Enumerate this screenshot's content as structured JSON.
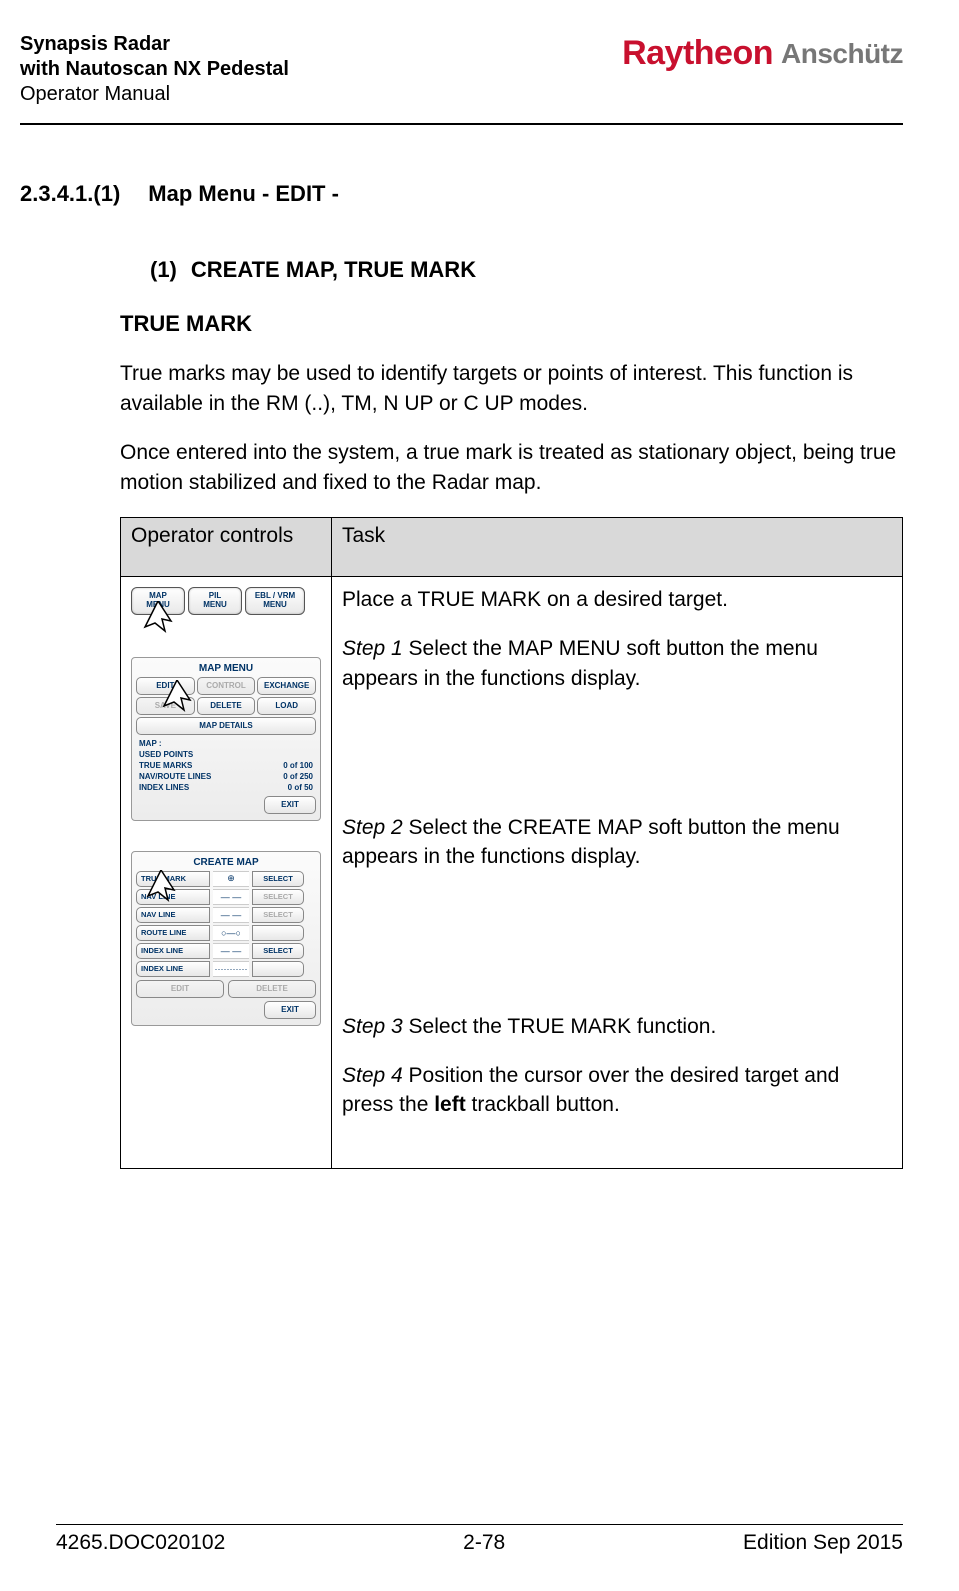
{
  "header": {
    "title1": "Synapsis Radar",
    "title2": "with Nautoscan NX Pedestal",
    "subtitle": "Operator Manual",
    "brand1": "Raytheon",
    "brand2": "Anschütz"
  },
  "section": {
    "num": "2.3.4.1.(1)",
    "title": "Map Menu - EDIT -",
    "sub_num": "(1)",
    "sub_title": "CREATE MAP, TRUE MARK",
    "subhead": "TRUE MARK",
    "para1": "True marks may be used to identify targets or points of interest. This function is available in the RM (..), TM, N UP or C UP modes.",
    "para2": "Once entered into the system, a true mark is treated as stationary object, being true motion stabilized and fixed to the Radar map."
  },
  "table": {
    "head_op": "Operator controls",
    "head_task": "Task",
    "task": {
      "place": "Place a TRUE MARK on a desired target.",
      "step1_label": "Step 1",
      "step1_text": " Select the MAP MENU soft button the menu appears in the functions display.",
      "step2_label": "Step 2",
      "step2_text": " Select the CREATE MAP soft button the menu appears in the functions display.",
      "step3_label": "Step 3",
      "step3_text": " Select the TRUE MARK function.",
      "step4_label": "Step 4",
      "step4_text_a": " Position the cursor over the desired target and press the ",
      "step4_bold": "left",
      "step4_text_b": " trackball button."
    }
  },
  "mini1": {
    "b1a": "MAP",
    "b1b": "MENU",
    "b2a": "PIL",
    "b2b": "MENU",
    "b3a": "EBL / VRM",
    "b3b": "MENU"
  },
  "mini2": {
    "title": "MAP MENU",
    "edit": "EDIT",
    "control": "CONTROL",
    "exchange": "EXCHANGE",
    "save": "SAVE",
    "delete": "DELETE",
    "load": "LOAD",
    "details": "MAP DETAILS",
    "map_lbl": "MAP :",
    "used_pts": "USED POINTS",
    "tm_lbl": "TRUE MARKS",
    "tm_val": "0  of   100",
    "nav_lbl": "NAV/ROUTE LINES",
    "nav_val": "0  of   250",
    "idx_lbl": "INDEX LINES",
    "idx_val": "0  of    50",
    "exit": "EXIT"
  },
  "mini3": {
    "title": "CREATE MAP",
    "true_mark": "TRUE MARK",
    "sym_plus": "⊕",
    "select": "SELECT",
    "nav_line": "NAV LINE",
    "route_line": "ROUTE LINE",
    "index_line": "INDEX LINE",
    "sym_dash": "— —",
    "sym_dots": "···········",
    "sym_chain": "○—○",
    "edit": "EDIT",
    "delete": "DELETE",
    "exit": "EXIT"
  },
  "footer": {
    "left": "4265.DOC020102",
    "center": "2-78",
    "right": "Edition Sep 2015"
  }
}
